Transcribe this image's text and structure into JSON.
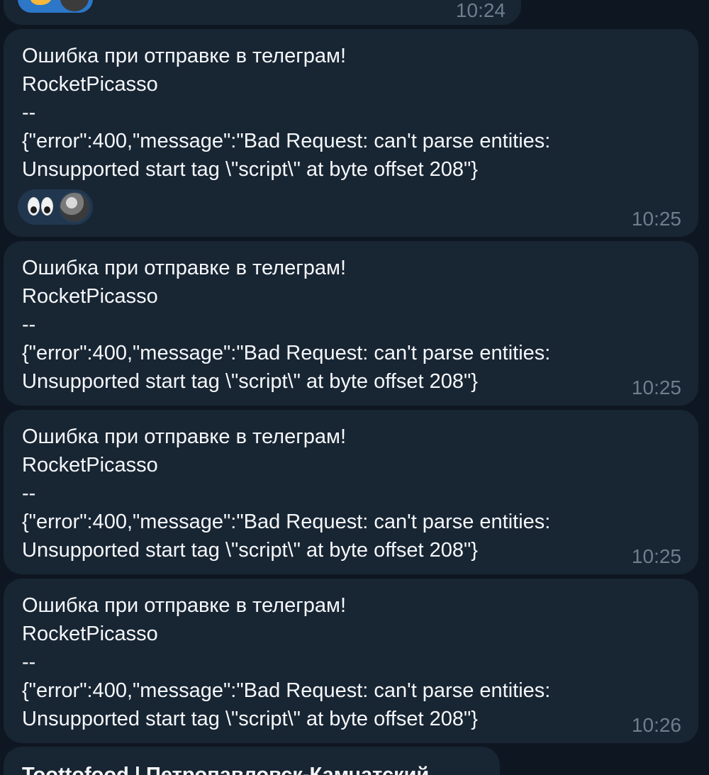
{
  "messages": [
    {
      "time": "10:24",
      "reactions": {
        "emoji": "clapping-hands",
        "has_avatar": true
      }
    },
    {
      "text": "Ошибка при отправке в телеграм!\nRocketPicasso\n--\n{\"error\":400,\"message\":\"Bad Request: can't parse entities:\nUnsupported start tag \\\"script\\\" at byte offset 208\"}",
      "time": "10:25",
      "reactions": {
        "emoji": "eyes",
        "has_avatar": true
      }
    },
    {
      "text": "Ошибка при отправке в телеграм!\nRocketPicasso\n--\n{\"error\":400,\"message\":\"Bad Request: can't parse entities:\nUnsupported start tag \\\"script\\\" at byte offset 208\"}",
      "time": "10:25"
    },
    {
      "text": "Ошибка при отправке в телеграм!\nRocketPicasso\n--\n{\"error\":400,\"message\":\"Bad Request: can't parse entities:\nUnsupported start tag \\\"script\\\" at byte offset 208\"}",
      "time": "10:25"
    },
    {
      "text": "Ошибка при отправке в телеграм!\nRocketPicasso\n--\n{\"error\":400,\"message\":\"Bad Request: can't parse entities:\nUnsupported start tag \\\"script\\\" at byte offset 208\"}",
      "time": "10:26"
    },
    {
      "title": "Toottofood | Петропавловск-Камчатский"
    }
  ],
  "colors": {
    "background": "#0e1621",
    "bubble": "#182533",
    "text": "#f5f7fa",
    "time": "#6d7f8f",
    "reaction_pill": "#20374f",
    "reaction_pill_active": "#2c77c8"
  }
}
